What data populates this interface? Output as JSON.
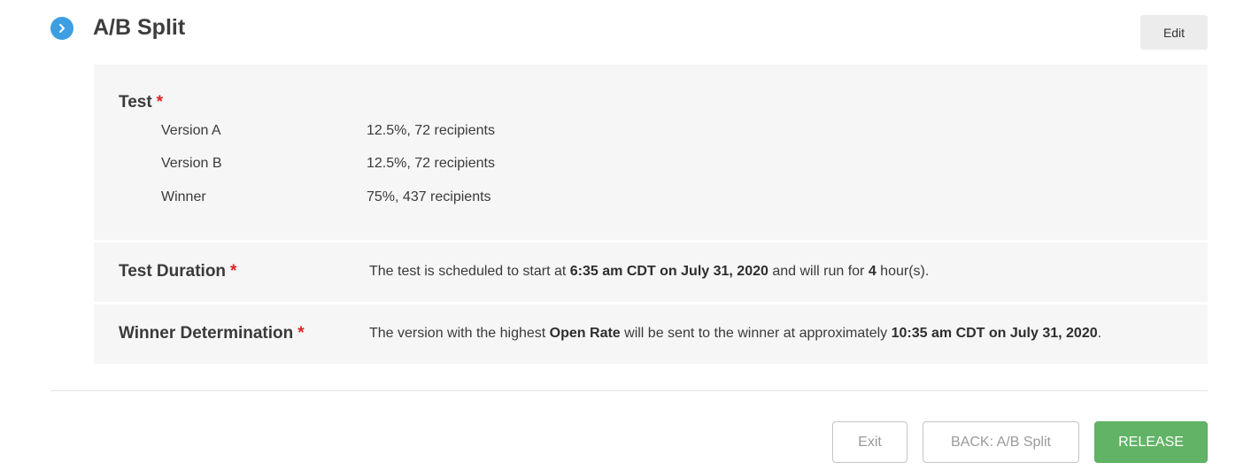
{
  "header": {
    "title": "A/B Split",
    "edit_label": "Edit",
    "step_icon": "chevron-right-icon",
    "accent_color": "#3d9ee2"
  },
  "test": {
    "label": "Test",
    "required_mark": "*",
    "rows": [
      {
        "label": "Version A",
        "value": "12.5%, 72 recipients"
      },
      {
        "label": "Version B",
        "value": "12.5%, 72 recipients"
      },
      {
        "label": "Winner",
        "value": "75%, 437 recipients"
      }
    ]
  },
  "duration": {
    "label": "Test Duration",
    "required_mark": "*",
    "text_1": "The test is scheduled to start at ",
    "start_time": "6:35 am CDT on July 31, 2020",
    "text_2": " and will run for ",
    "hours": "4",
    "text_3": " hour(s)."
  },
  "winner_determination": {
    "label": "Winner Determination",
    "required_mark": "*",
    "text_1": "The version with the highest ",
    "metric": "Open Rate",
    "text_2": " will be sent to the winner at approximately ",
    "send_time": "10:35 am CDT on July 31, 2020",
    "text_3": "."
  },
  "footer": {
    "exit_label": "Exit",
    "back_label": "BACK: A/B Split",
    "release_label": "RELEASE",
    "release_color": "#62b366"
  }
}
